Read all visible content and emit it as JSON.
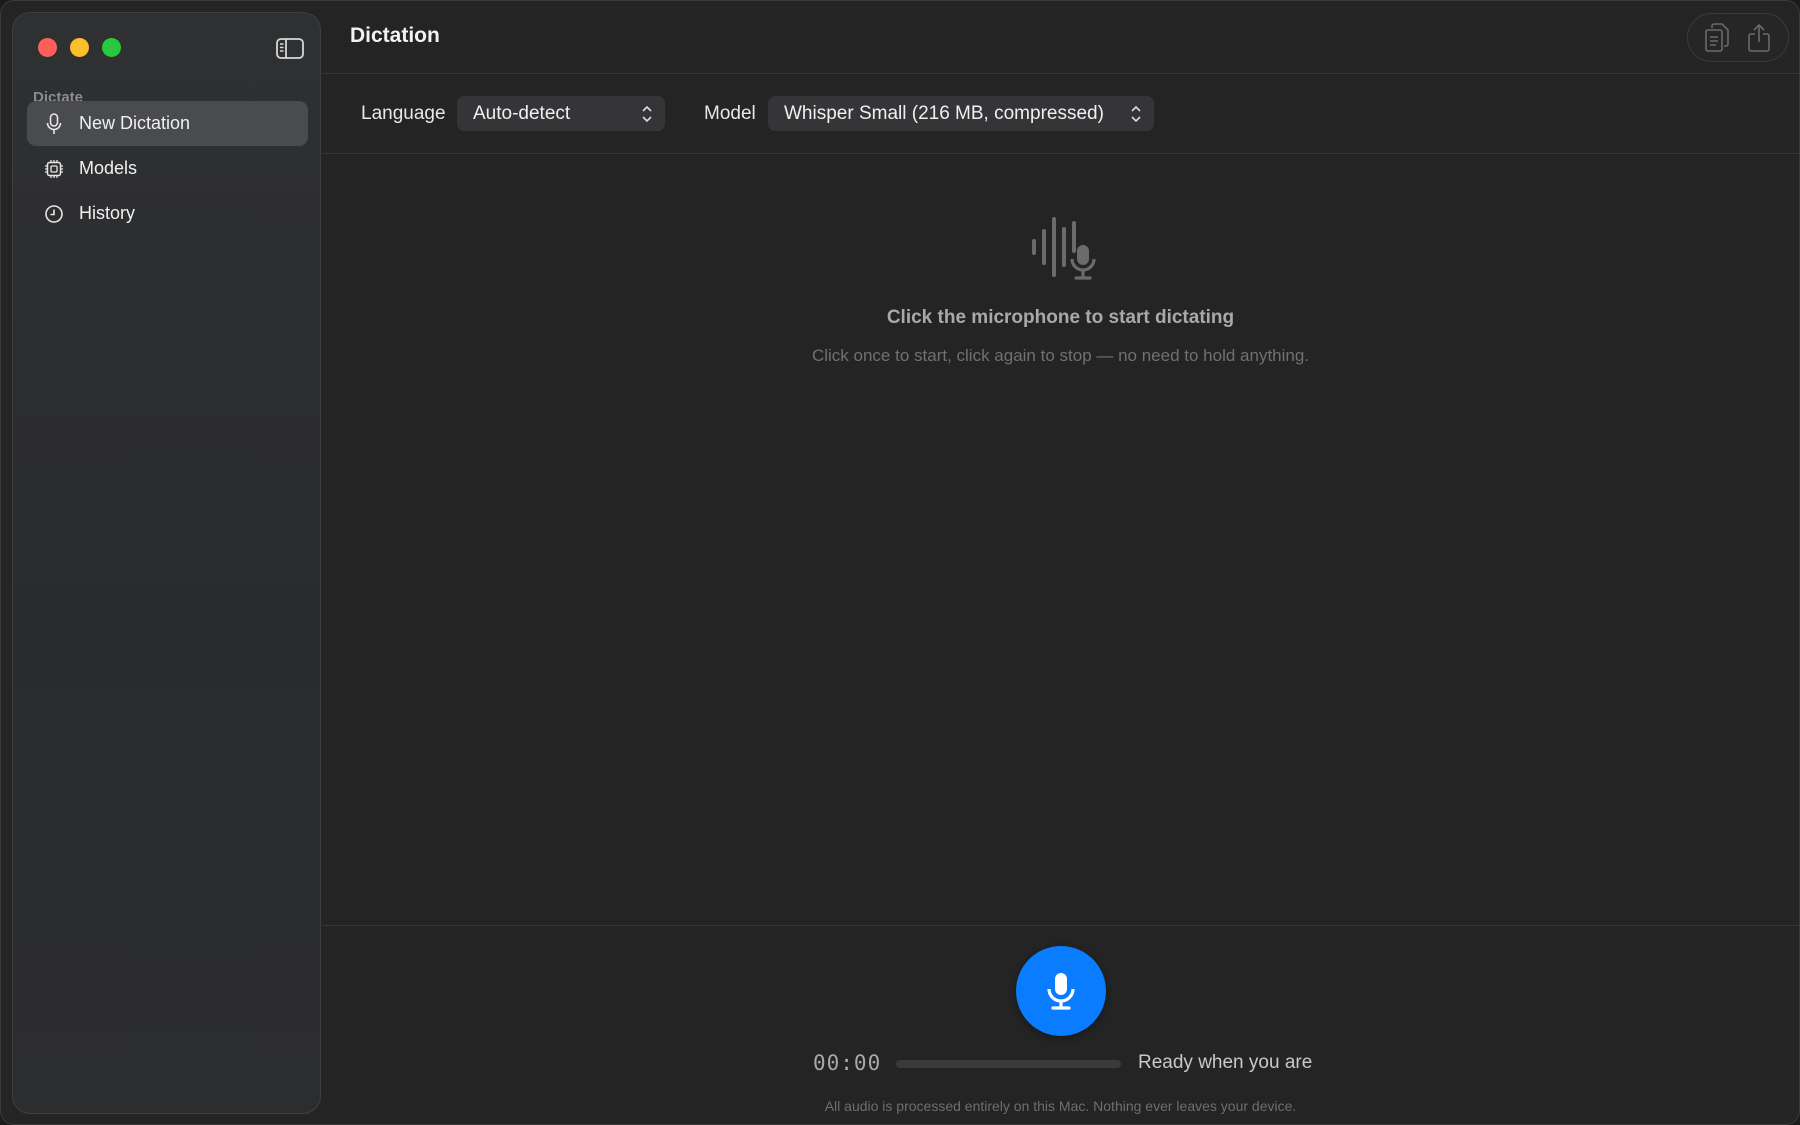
{
  "window": {
    "title": "Dictation"
  },
  "sidebar": {
    "section_label": "Dictate",
    "items": [
      {
        "label": "New Dictation",
        "icon": "microphone-icon",
        "active": true
      },
      {
        "label": "Models",
        "icon": "chip-icon",
        "active": false
      },
      {
        "label": "History",
        "icon": "clock-icon",
        "active": false
      }
    ]
  },
  "toolbar": {
    "buttons": [
      {
        "icon": "copy-icon",
        "enabled": false
      },
      {
        "icon": "share-icon",
        "enabled": false
      }
    ]
  },
  "controls": {
    "language_label": "Language",
    "language_value": "Auto-detect",
    "model_label": "Model",
    "model_value": "Whisper Small (216 MB, compressed)"
  },
  "empty_state": {
    "icon": "waveform-microphone-icon",
    "title": "Click the microphone to start dictating",
    "subtitle": "Click once to start, click again to stop — no need to hold anything."
  },
  "recorder": {
    "timer": "00:00",
    "level": 0,
    "status": "Ready when you are",
    "privacy_note": "All audio is processed entirely on this Mac. Nothing ever leaves your device."
  },
  "colors": {
    "accent": "#0a7cff",
    "close": "#ff5f57",
    "minimize": "#febc2e",
    "zoom": "#28c840"
  }
}
